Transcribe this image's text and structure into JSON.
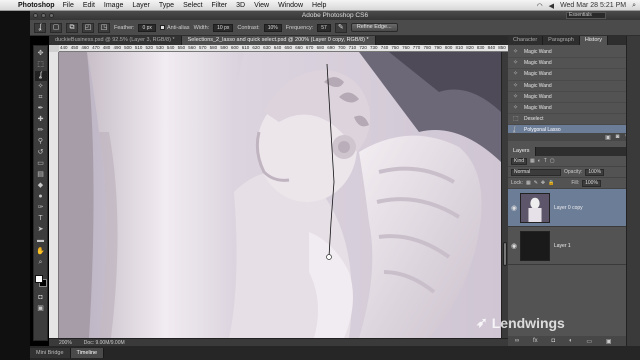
{
  "menubar": {
    "app_name": "Photoshop",
    "items": [
      "File",
      "Edit",
      "Image",
      "Layer",
      "Type",
      "Select",
      "Filter",
      "3D",
      "View",
      "Window",
      "Help"
    ],
    "clock": "Wed Mar 28  5:21 PM",
    "clock_secondary": "Wed Mar 28  5:21 PM"
  },
  "titlebar": {
    "title": "Adobe Photoshop CS6",
    "workspace": "Essentials"
  },
  "options": {
    "feather_label": "Feather:",
    "feather_value": "0 px",
    "antialias_label": "Anti-alias",
    "width_label": "Width:",
    "width_value": "10 px",
    "contrast_label": "Contrast:",
    "contrast_value": "10%",
    "frequency_label": "Frequency:",
    "frequency_value": "57",
    "refine_label": "Refine Edge..."
  },
  "tabs": [
    {
      "label": "duckieBusiness.psd @ 92.5% (Layer 3, RGB/8) *",
      "active": false
    },
    {
      "label": "Selections_2_lasso and quick select.psd @ 200% (Layer 0 copy, RGB/8) *",
      "active": true
    }
  ],
  "ruler": {
    "ticks": [
      "440",
      "450",
      "460",
      "470",
      "480",
      "490",
      "500",
      "510",
      "520",
      "530",
      "540",
      "550",
      "560",
      "570",
      "580",
      "590",
      "600",
      "610",
      "620",
      "630",
      "640",
      "650",
      "660",
      "670",
      "680",
      "690",
      "700",
      "710",
      "720",
      "730",
      "740",
      "750",
      "760",
      "770",
      "780",
      "790",
      "800",
      "810",
      "820",
      "830",
      "840",
      "850"
    ]
  },
  "status": {
    "zoom": "200%",
    "doc": "Doc: 9.00M/9.00M"
  },
  "bottom_tabs": [
    "Mini Bridge",
    "Timeline"
  ],
  "panel_tabs": [
    "Character",
    "Paragraph",
    "History"
  ],
  "history": [
    {
      "label": "Magic Wand",
      "selected": false
    },
    {
      "label": "Magic Wand",
      "selected": false
    },
    {
      "label": "Magic Wand",
      "selected": false
    },
    {
      "label": "Magic Wand",
      "selected": false
    },
    {
      "label": "Magic Wand",
      "selected": false
    },
    {
      "label": "Magic Wand",
      "selected": false
    },
    {
      "label": "Deselect",
      "selected": false
    },
    {
      "label": "Polygonal Lasso",
      "selected": true
    }
  ],
  "layers": {
    "tab": "Layers",
    "kind_label": "Kind",
    "blend_mode": "Normal",
    "opacity_label": "Opacity:",
    "opacity_value": "100%",
    "lock_label": "Lock:",
    "fill_label": "Fill:",
    "fill_value": "100%",
    "rows": [
      {
        "name": "Layer 0 copy",
        "selected": true
      },
      {
        "name": "Layer 1",
        "selected": false
      }
    ]
  },
  "watermark": "Lendwings",
  "colors": {
    "selection_blue": "#6c7d98",
    "panel_gray": "#535353",
    "canvas_bg": "#e4dfe6"
  }
}
